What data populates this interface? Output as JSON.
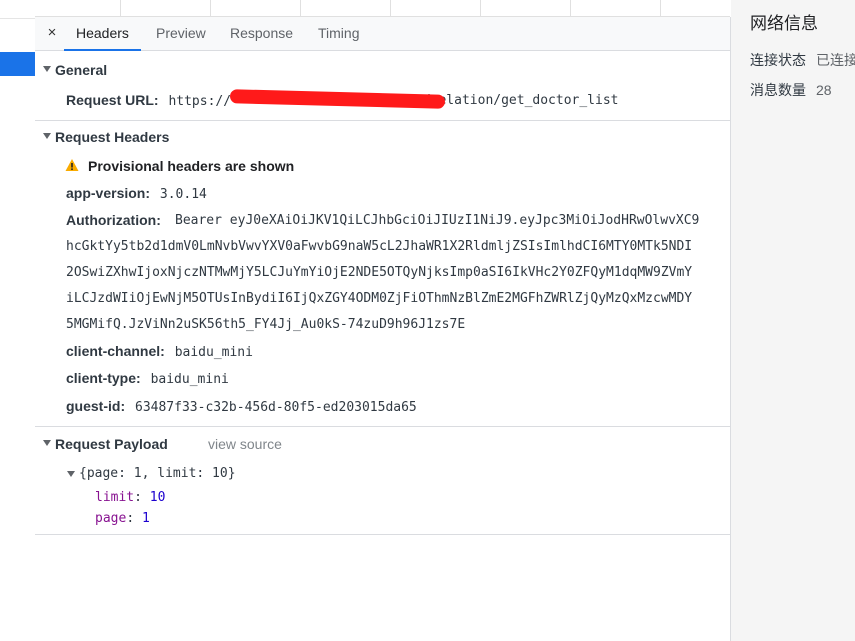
{
  "tabs": [
    {
      "label": "Headers",
      "active": true
    },
    {
      "label": "Preview",
      "active": false
    },
    {
      "label": "Response",
      "active": false
    },
    {
      "label": "Timing",
      "active": false
    }
  ],
  "close_glyph": "×",
  "general": {
    "title": "General",
    "request_url_key": "Request URL:",
    "request_url_prefix": "https://",
    "request_url_suffix": "r/relation/get_doctor_list"
  },
  "request_headers": {
    "title": "Request Headers",
    "provisional": "Provisional headers are shown",
    "app_version_key": "app-version:",
    "app_version_val": "3.0.14",
    "authorization_key": "Authorization:",
    "authorization_lines": [
      "Bearer eyJ0eXAiOiJKV1QiLCJhbGciOiJIUzI1NiJ9.eyJpc3MiOiJodHRwOlwvXC9",
      "hcGktYy5tb2d1dmV0LmNvbVwvYXV0aFwvbG9naW5cL2JhaWR1X2RldmljZSIsImlhdCI6MTY0MTk5NDI",
      "2OSwiZXhwIjoxNjczNTMwMjY5LCJuYmYiOjE2NDE5OTQyNjksImp0aSI6IkVHc2Y0ZFQyM1dqMW9ZVmY",
      "iLCJzdWIiOjEwNjM5OTUsInBydiI6IjQxZGY4ODM0ZjFiOThmNzBlZmE2MGFhZWRlZjQyMzQxMzcwMDY",
      "5MGMifQ.JzViNn2uSK56th5_FY4Jj_Au0kS-74zuD9h96J1zs7E"
    ],
    "client_channel_key": "client-channel:",
    "client_channel_val": "baidu_mini",
    "client_type_key": "client-type:",
    "client_type_val": "baidu_mini",
    "guest_id_key": "guest-id:",
    "guest_id_val": "63487f33-c32b-456d-80f5-ed203015da65"
  },
  "payload": {
    "title": "Request Payload",
    "view_source": "view source",
    "summary": "{page: 1, limit: 10}",
    "rows": [
      {
        "key": "limit",
        "value": "10"
      },
      {
        "key": "page",
        "value": "1"
      }
    ]
  },
  "side_panel": {
    "title": "网络信息",
    "rows": [
      {
        "label": "连接状态",
        "value": "已连接"
      },
      {
        "label": "消息数量",
        "value": "28"
      }
    ]
  },
  "colors": {
    "accent": "#1a73e8",
    "redaction": "#ff1a1a",
    "warning": "#f9ab00",
    "payload_key": "#881391",
    "payload_value": "#1c00cf"
  },
  "icons": [
    "close-icon",
    "warning-icon",
    "expand-triangle-icon"
  ]
}
